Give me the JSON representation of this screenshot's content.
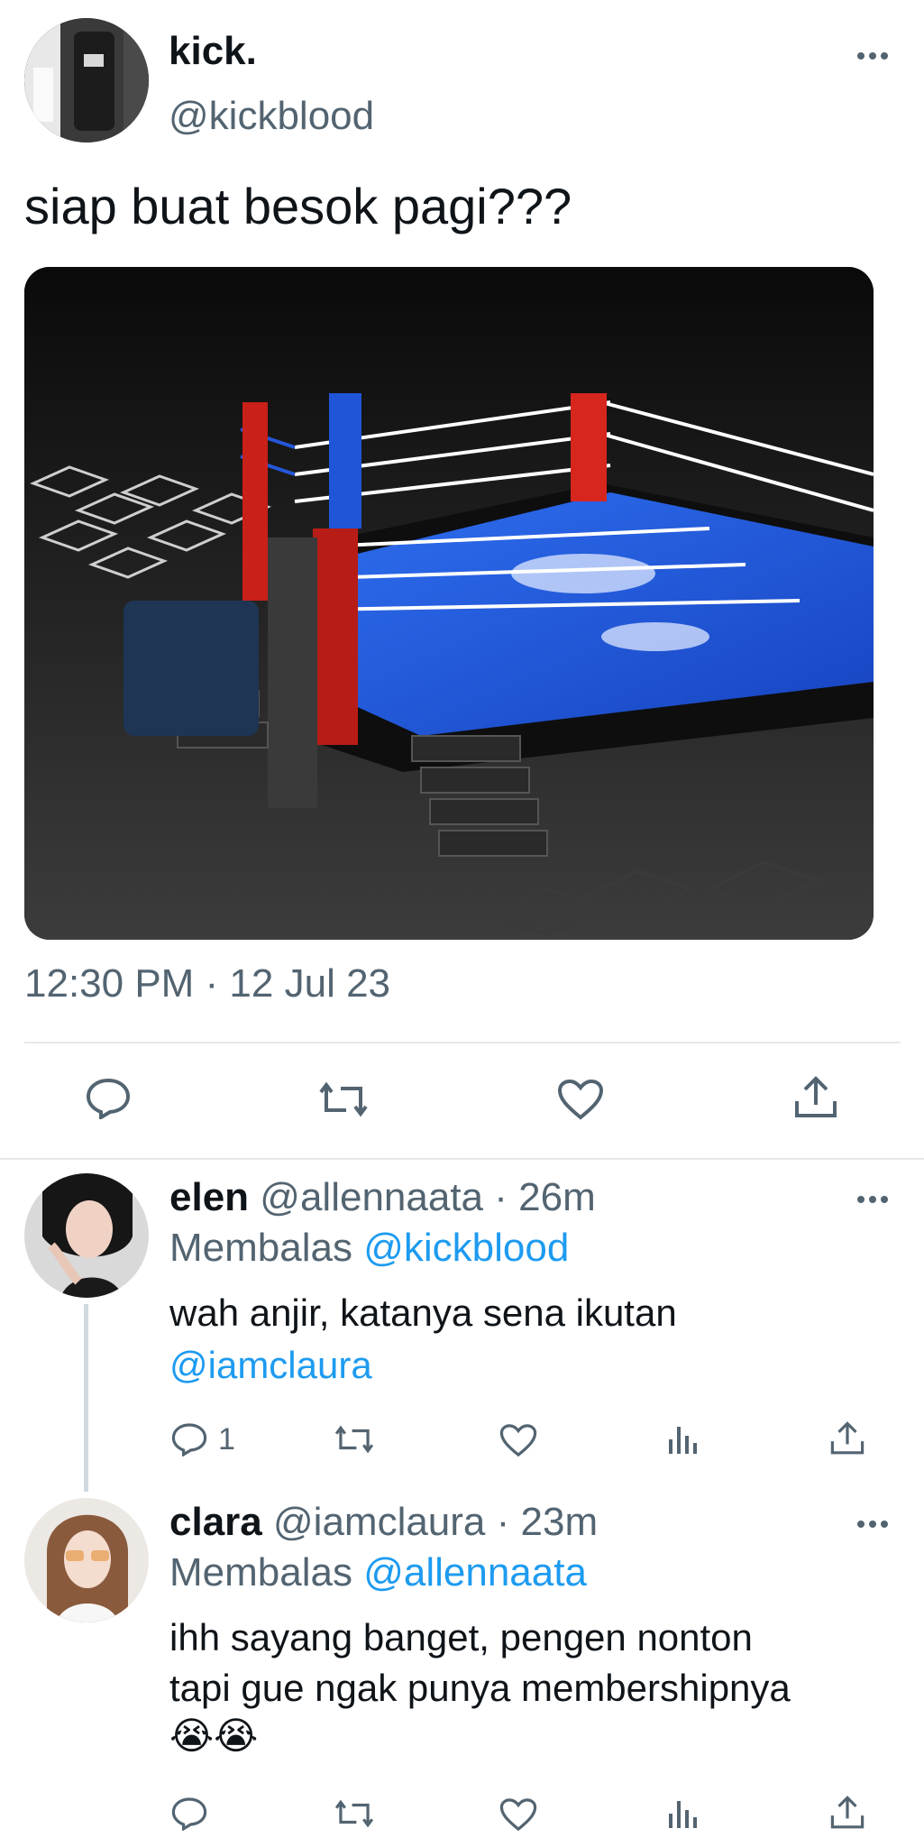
{
  "tweet": {
    "display_name": "kick.",
    "handle": "@kickblood",
    "text": "siap buat besok pagi???",
    "timestamp": "12:30 PM · 12 Jul 23",
    "more_icon": "more-horizontal-icon",
    "actions": [
      "reply-icon",
      "retweet-icon",
      "like-icon",
      "share-icon"
    ]
  },
  "replies": [
    {
      "name": "elen",
      "handle": "@allennaata",
      "sep": "·",
      "time": "26m",
      "replying_label": "Membalas",
      "replying_to": "@kickblood",
      "text_line1": "wah anjir, katanya sena ikutan",
      "text_mention": "@iamclaura",
      "reply_count": "1"
    },
    {
      "name": "clara",
      "handle": "@iamclaura",
      "sep": "·",
      "time": "23m",
      "replying_label": "Membalas",
      "replying_to": "@allennaata",
      "text_line1": "ihh sayang banget, pengen nonton",
      "text_line2": "tapi gue ngak punya membershipnya",
      "emoji": "😭😭",
      "reply_count": ""
    }
  ],
  "colors": {
    "ring_blue": "#1f55d6",
    "corner_red": "#d7261e",
    "link": "#1d9bf0",
    "muted": "#536471"
  }
}
